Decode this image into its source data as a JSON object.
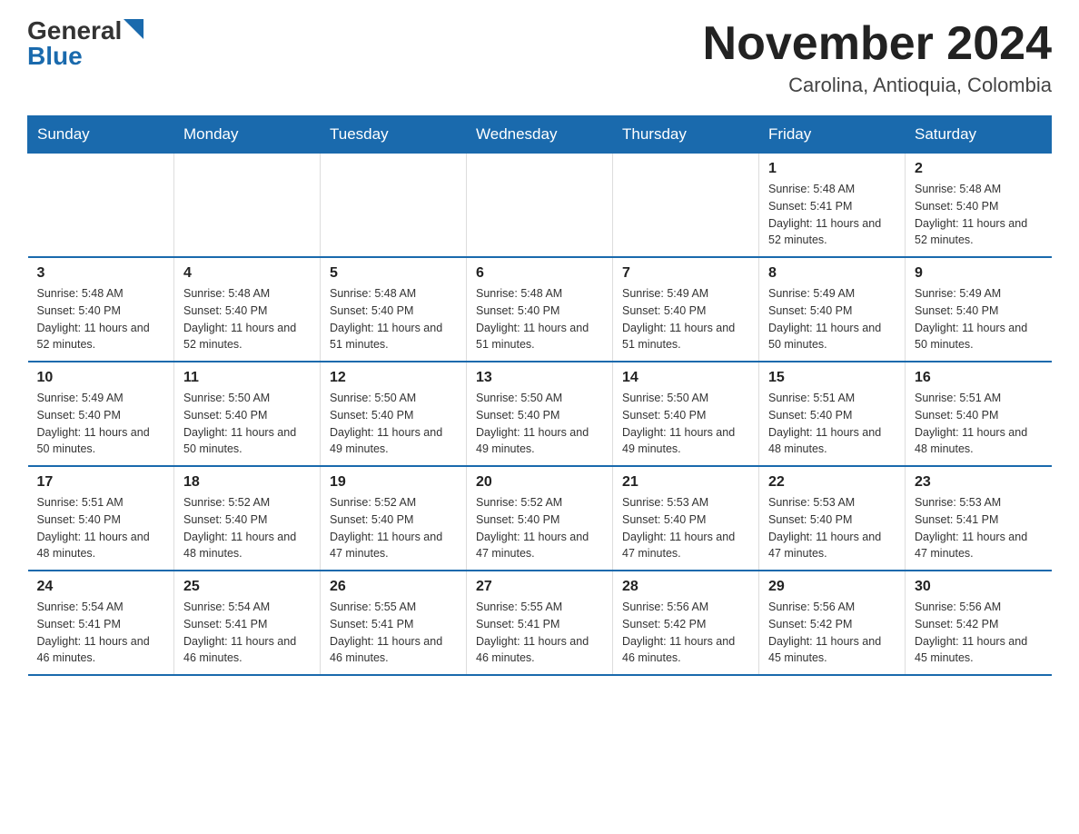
{
  "header": {
    "logo_general": "General",
    "logo_blue": "Blue",
    "title": "November 2024",
    "location": "Carolina, Antioquia, Colombia"
  },
  "days_of_week": [
    "Sunday",
    "Monday",
    "Tuesday",
    "Wednesday",
    "Thursday",
    "Friday",
    "Saturday"
  ],
  "weeks": [
    [
      {
        "day": "",
        "sunrise": "",
        "sunset": "",
        "daylight": ""
      },
      {
        "day": "",
        "sunrise": "",
        "sunset": "",
        "daylight": ""
      },
      {
        "day": "",
        "sunrise": "",
        "sunset": "",
        "daylight": ""
      },
      {
        "day": "",
        "sunrise": "",
        "sunset": "",
        "daylight": ""
      },
      {
        "day": "",
        "sunrise": "",
        "sunset": "",
        "daylight": ""
      },
      {
        "day": "1",
        "sunrise": "Sunrise: 5:48 AM",
        "sunset": "Sunset: 5:41 PM",
        "daylight": "Daylight: 11 hours and 52 minutes."
      },
      {
        "day": "2",
        "sunrise": "Sunrise: 5:48 AM",
        "sunset": "Sunset: 5:40 PM",
        "daylight": "Daylight: 11 hours and 52 minutes."
      }
    ],
    [
      {
        "day": "3",
        "sunrise": "Sunrise: 5:48 AM",
        "sunset": "Sunset: 5:40 PM",
        "daylight": "Daylight: 11 hours and 52 minutes."
      },
      {
        "day": "4",
        "sunrise": "Sunrise: 5:48 AM",
        "sunset": "Sunset: 5:40 PM",
        "daylight": "Daylight: 11 hours and 52 minutes."
      },
      {
        "day": "5",
        "sunrise": "Sunrise: 5:48 AM",
        "sunset": "Sunset: 5:40 PM",
        "daylight": "Daylight: 11 hours and 51 minutes."
      },
      {
        "day": "6",
        "sunrise": "Sunrise: 5:48 AM",
        "sunset": "Sunset: 5:40 PM",
        "daylight": "Daylight: 11 hours and 51 minutes."
      },
      {
        "day": "7",
        "sunrise": "Sunrise: 5:49 AM",
        "sunset": "Sunset: 5:40 PM",
        "daylight": "Daylight: 11 hours and 51 minutes."
      },
      {
        "day": "8",
        "sunrise": "Sunrise: 5:49 AM",
        "sunset": "Sunset: 5:40 PM",
        "daylight": "Daylight: 11 hours and 50 minutes."
      },
      {
        "day": "9",
        "sunrise": "Sunrise: 5:49 AM",
        "sunset": "Sunset: 5:40 PM",
        "daylight": "Daylight: 11 hours and 50 minutes."
      }
    ],
    [
      {
        "day": "10",
        "sunrise": "Sunrise: 5:49 AM",
        "sunset": "Sunset: 5:40 PM",
        "daylight": "Daylight: 11 hours and 50 minutes."
      },
      {
        "day": "11",
        "sunrise": "Sunrise: 5:50 AM",
        "sunset": "Sunset: 5:40 PM",
        "daylight": "Daylight: 11 hours and 50 minutes."
      },
      {
        "day": "12",
        "sunrise": "Sunrise: 5:50 AM",
        "sunset": "Sunset: 5:40 PM",
        "daylight": "Daylight: 11 hours and 49 minutes."
      },
      {
        "day": "13",
        "sunrise": "Sunrise: 5:50 AM",
        "sunset": "Sunset: 5:40 PM",
        "daylight": "Daylight: 11 hours and 49 minutes."
      },
      {
        "day": "14",
        "sunrise": "Sunrise: 5:50 AM",
        "sunset": "Sunset: 5:40 PM",
        "daylight": "Daylight: 11 hours and 49 minutes."
      },
      {
        "day": "15",
        "sunrise": "Sunrise: 5:51 AM",
        "sunset": "Sunset: 5:40 PM",
        "daylight": "Daylight: 11 hours and 48 minutes."
      },
      {
        "day": "16",
        "sunrise": "Sunrise: 5:51 AM",
        "sunset": "Sunset: 5:40 PM",
        "daylight": "Daylight: 11 hours and 48 minutes."
      }
    ],
    [
      {
        "day": "17",
        "sunrise": "Sunrise: 5:51 AM",
        "sunset": "Sunset: 5:40 PM",
        "daylight": "Daylight: 11 hours and 48 minutes."
      },
      {
        "day": "18",
        "sunrise": "Sunrise: 5:52 AM",
        "sunset": "Sunset: 5:40 PM",
        "daylight": "Daylight: 11 hours and 48 minutes."
      },
      {
        "day": "19",
        "sunrise": "Sunrise: 5:52 AM",
        "sunset": "Sunset: 5:40 PM",
        "daylight": "Daylight: 11 hours and 47 minutes."
      },
      {
        "day": "20",
        "sunrise": "Sunrise: 5:52 AM",
        "sunset": "Sunset: 5:40 PM",
        "daylight": "Daylight: 11 hours and 47 minutes."
      },
      {
        "day": "21",
        "sunrise": "Sunrise: 5:53 AM",
        "sunset": "Sunset: 5:40 PM",
        "daylight": "Daylight: 11 hours and 47 minutes."
      },
      {
        "day": "22",
        "sunrise": "Sunrise: 5:53 AM",
        "sunset": "Sunset: 5:40 PM",
        "daylight": "Daylight: 11 hours and 47 minutes."
      },
      {
        "day": "23",
        "sunrise": "Sunrise: 5:53 AM",
        "sunset": "Sunset: 5:41 PM",
        "daylight": "Daylight: 11 hours and 47 minutes."
      }
    ],
    [
      {
        "day": "24",
        "sunrise": "Sunrise: 5:54 AM",
        "sunset": "Sunset: 5:41 PM",
        "daylight": "Daylight: 11 hours and 46 minutes."
      },
      {
        "day": "25",
        "sunrise": "Sunrise: 5:54 AM",
        "sunset": "Sunset: 5:41 PM",
        "daylight": "Daylight: 11 hours and 46 minutes."
      },
      {
        "day": "26",
        "sunrise": "Sunrise: 5:55 AM",
        "sunset": "Sunset: 5:41 PM",
        "daylight": "Daylight: 11 hours and 46 minutes."
      },
      {
        "day": "27",
        "sunrise": "Sunrise: 5:55 AM",
        "sunset": "Sunset: 5:41 PM",
        "daylight": "Daylight: 11 hours and 46 minutes."
      },
      {
        "day": "28",
        "sunrise": "Sunrise: 5:56 AM",
        "sunset": "Sunset: 5:42 PM",
        "daylight": "Daylight: 11 hours and 46 minutes."
      },
      {
        "day": "29",
        "sunrise": "Sunrise: 5:56 AM",
        "sunset": "Sunset: 5:42 PM",
        "daylight": "Daylight: 11 hours and 45 minutes."
      },
      {
        "day": "30",
        "sunrise": "Sunrise: 5:56 AM",
        "sunset": "Sunset: 5:42 PM",
        "daylight": "Daylight: 11 hours and 45 minutes."
      }
    ]
  ]
}
